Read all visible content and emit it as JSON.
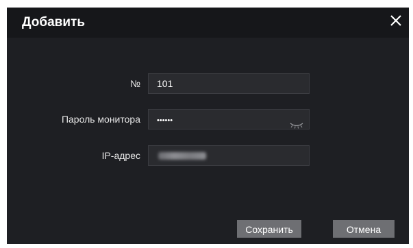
{
  "dialog": {
    "title": "Добавить",
    "close_icon": "close-icon"
  },
  "form": {
    "number_label": "№",
    "number_value": "101",
    "password_label": "Пароль монитора",
    "password_value": "••••••",
    "password_toggle_icon": "eye-closed-icon",
    "ip_label": "IP-адрес",
    "ip_value_obscured": true
  },
  "buttons": {
    "save_label": "Сохранить",
    "cancel_label": "Отмена"
  }
}
